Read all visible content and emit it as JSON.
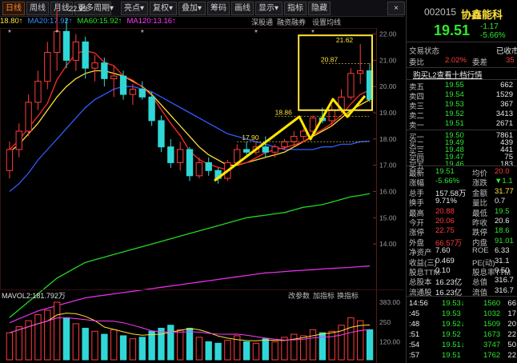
{
  "toolbar": {
    "items": [
      {
        "label": "日线",
        "active": true
      },
      {
        "label": "周线"
      },
      {
        "label": "月线"
      },
      {
        "label": "更多周期▾"
      },
      {
        "label": "亮点▾"
      },
      {
        "label": "复权▾"
      },
      {
        "label": "叠加▾"
      },
      {
        "label": "筹码"
      },
      {
        "label": "画线"
      },
      {
        "label": "显示▾"
      },
      {
        "label": "指标"
      },
      {
        "label": "隐藏"
      }
    ],
    "close_icon": "×"
  },
  "ma_legend": [
    {
      "text": "18.80↑",
      "color": "#ffe33a"
    },
    {
      "text": "MA20:17.92↑",
      "color": "#3a8cff"
    },
    {
      "text": "MA60:15.92↑",
      "color": "#2ee62e"
    },
    {
      "text": "MA120:13.16↑",
      "color": "#ff3bff"
    }
  ],
  "chart_links": [
    "深股通",
    "融资融券",
    "设置均线"
  ],
  "price_axis": [
    "22.00",
    "21.00",
    "20.00",
    "19.00",
    "18.00",
    "17.00",
    "16.00",
    "15.00",
    "14.00"
  ],
  "annotations": {
    "high_label": "←22.99",
    "box_top": "21.62",
    "line1": "20.87",
    "line2": "18.86",
    "line3": "17.90"
  },
  "chart_data": {
    "type": "candlestick",
    "ohlc": [
      [
        16.8,
        17.9,
        16.5,
        17.6
      ],
      [
        17.6,
        18.6,
        17.3,
        18.3
      ],
      [
        18.3,
        19.7,
        18.1,
        19.4
      ],
      [
        19.4,
        20.6,
        19.1,
        20.2
      ],
      [
        20.2,
        21.7,
        19.9,
        21.3
      ],
      [
        21.3,
        22.99,
        20.6,
        22.1
      ],
      [
        22.1,
        22.6,
        20.7,
        21.0
      ],
      [
        21.0,
        22.0,
        20.6,
        21.7
      ],
      [
        21.7,
        21.9,
        20.3,
        20.7
      ],
      [
        20.7,
        21.2,
        20.2,
        20.9
      ],
      [
        20.9,
        21.1,
        20.0,
        20.3
      ],
      [
        20.3,
        20.8,
        19.6,
        20.4
      ],
      [
        20.4,
        20.6,
        19.5,
        19.7
      ],
      [
        19.7,
        20.1,
        19.3,
        19.9
      ],
      [
        19.9,
        20.2,
        19.5,
        19.6
      ],
      [
        19.6,
        19.8,
        18.5,
        18.7
      ],
      [
        18.7,
        18.9,
        17.5,
        17.7
      ],
      [
        17.7,
        18.0,
        16.9,
        17.1
      ],
      [
        17.1,
        17.9,
        16.8,
        17.6
      ],
      [
        17.6,
        17.7,
        16.4,
        16.6
      ],
      [
        16.6,
        17.3,
        16.5,
        17.1
      ],
      [
        17.1,
        17.3,
        16.6,
        16.8
      ],
      [
        16.8,
        16.9,
        16.3,
        16.5
      ],
      [
        16.5,
        17.2,
        16.4,
        17.1
      ],
      [
        17.1,
        17.8,
        17.0,
        17.6
      ],
      [
        17.6,
        17.9,
        17.4,
        17.5
      ],
      [
        17.5,
        17.9,
        17.4,
        17.7
      ],
      [
        17.7,
        18.1,
        17.3,
        17.5
      ],
      [
        17.5,
        17.8,
        17.3,
        17.7
      ],
      [
        17.7,
        18.0,
        17.6,
        17.9
      ],
      [
        17.9,
        18.3,
        17.7,
        18.1
      ],
      [
        18.1,
        18.4,
        17.9,
        18.3
      ],
      [
        18.3,
        18.9,
        18.2,
        18.8
      ],
      [
        18.8,
        19.2,
        18.6,
        18.7
      ],
      [
        18.7,
        19.3,
        18.5,
        19.1
      ],
      [
        19.1,
        19.9,
        19.0,
        19.6
      ],
      [
        19.6,
        20.7,
        19.5,
        20.5
      ],
      [
        20.5,
        21.62,
        20.1,
        20.6
      ],
      [
        20.6,
        20.9,
        19.4,
        19.51
      ]
    ],
    "ma_short": [
      17.5,
      17.8,
      18.2,
      18.6,
      19.1,
      19.6,
      20.0,
      20.3,
      20.5,
      20.6,
      20.6,
      20.5,
      20.4,
      20.2,
      20.0,
      19.7,
      19.3,
      18.9,
      18.5,
      18.1,
      17.7,
      17.4,
      17.2,
      17.0,
      17.0,
      17.1,
      17.2,
      17.3,
      17.4,
      17.5,
      17.7,
      17.9,
      18.1,
      18.3,
      18.5,
      18.8,
      19.1,
      19.3,
      19.5
    ],
    "ma20": [
      16.0,
      16.3,
      16.7,
      17.2,
      17.6,
      18.0,
      18.4,
      18.8,
      19.2,
      19.5,
      19.7,
      19.9,
      20.0,
      20.0,
      19.9,
      19.8,
      19.6,
      19.4,
      19.2,
      19.0,
      18.8,
      18.6,
      18.4,
      18.2,
      18.1,
      18.0,
      17.9,
      17.8,
      17.7,
      17.6,
      17.6,
      17.6,
      17.6,
      17.7,
      17.7,
      17.8,
      17.8,
      17.9,
      17.92
    ],
    "ma60": [
      11.2,
      11.5,
      11.8,
      12.1,
      12.4,
      12.7,
      12.9,
      13.1,
      13.3,
      13.4,
      13.5,
      13.6,
      13.7,
      13.8,
      13.9,
      14.0,
      14.1,
      14.2,
      14.3,
      14.4,
      14.5,
      14.6,
      14.7,
      14.8,
      14.9,
      15.0,
      15.05,
      15.1,
      15.15,
      15.2,
      15.3,
      15.4,
      15.45,
      15.5,
      15.6,
      15.7,
      15.8,
      15.85,
      15.92
    ],
    "ma120": [
      11.0,
      11.15,
      11.3,
      11.45,
      11.55,
      11.65,
      11.75,
      11.85,
      11.95,
      12.0,
      12.05,
      12.1,
      12.15,
      12.2,
      12.25,
      12.3,
      12.35,
      12.4,
      12.45,
      12.5,
      12.55,
      12.6,
      12.65,
      12.7,
      12.75,
      12.8,
      12.85,
      12.9,
      12.92,
      12.95,
      12.98,
      13.0,
      13.02,
      13.05,
      13.07,
      13.09,
      13.11,
      13.14,
      13.16
    ],
    "ylim": [
      13.0,
      22.2
    ],
    "volume": [
      180,
      220,
      260,
      300,
      330,
      383,
      280,
      240,
      210,
      190,
      170,
      200,
      160,
      140,
      150,
      190,
      210,
      230,
      200,
      210,
      150,
      120,
      110,
      130,
      160,
      120,
      110,
      140,
      120,
      150,
      170,
      160,
      200,
      180,
      190,
      230,
      280,
      260,
      200
    ],
    "vol_ylim": [
      0,
      383
    ],
    "vol_axis": [
      "383.00",
      "250",
      "120.00"
    ],
    "vol_legend": "MAVOL2:181.792万",
    "vol_links": [
      "改参数",
      "加指标",
      "换指标"
    ]
  },
  "stock": {
    "code": "002015",
    "name": "协鑫能科",
    "price": "19.51",
    "change": "-1.17",
    "change_pct": "-5.66%"
  },
  "panel": {
    "trade_status_label": "交易状态",
    "trade_status_value": "已收市",
    "wb_label": "委比",
    "wb_value": "2.02%",
    "wc_label": "委差",
    "wc_value": "35",
    "l2_link": "购买L2查看十档行情",
    "asks": [
      {
        "label": "卖五",
        "price": "19.55",
        "vol": "662"
      },
      {
        "label": "卖四",
        "price": "19.54",
        "vol": "1529"
      },
      {
        "label": "卖三",
        "price": "19.53",
        "vol": "367"
      },
      {
        "label": "卖二",
        "price": "19.52",
        "vol": "3413"
      },
      {
        "label": "卖一",
        "price": "19.51",
        "vol": "2671"
      }
    ],
    "bids": [
      {
        "label": "买一",
        "price": "19.50",
        "vol": "7861"
      },
      {
        "label": "买二",
        "price": "19.49",
        "vol": "439"
      },
      {
        "label": "买三",
        "price": "19.48",
        "vol": "441"
      },
      {
        "label": "买四",
        "price": "19.47",
        "vol": "75"
      },
      {
        "label": "买五",
        "price": "19.46",
        "vol": "183"
      }
    ],
    "stats": [
      {
        "l1": "最新",
        "v1": "19.51",
        "c1": "green",
        "l2": "均价",
        "v2": "20.0",
        "c2": "red"
      },
      {
        "l1": "涨幅",
        "v1": "-5.66%",
        "c1": "green",
        "l2": "涨跌",
        "v2": "▼1.1",
        "c2": "green"
      },
      {
        "l1": "总手",
        "v1": "157.58万",
        "c1": "white",
        "l2": "金额",
        "v2": "31.77",
        "c2": "yellow"
      },
      {
        "l1": "换手",
        "v1": "9.71%",
        "c1": "white",
        "l2": "量比",
        "v2": "0.7",
        "c2": "white"
      },
      {
        "l1": "最高",
        "v1": "20.88",
        "c1": "red",
        "l2": "最低",
        "v2": "19.5",
        "c2": "green"
      },
      {
        "l1": "今开",
        "v1": "20.06",
        "c1": "red",
        "l2": "昨收",
        "v2": "20.6",
        "c2": "white"
      },
      {
        "l1": "涨停",
        "v1": "22.75",
        "c1": "red",
        "l2": "跌停",
        "v2": "18.6",
        "c2": "green"
      },
      {
        "l1": "外盘",
        "v1": "66.57万",
        "c1": "red",
        "l2": "内盘",
        "v2": "91.01",
        "c2": "green"
      },
      {
        "l1": "净资产",
        "v1": "7.60",
        "c1": "white",
        "l2": "ROE",
        "v2": "6.33",
        "c2": "white"
      },
      {
        "l1": "收益(三)",
        "v1": "0.469",
        "c1": "white",
        "l2": "PE(动)",
        "v2": "31.1",
        "c2": "white"
      },
      {
        "l1": "股息TTM",
        "v1": "0.10",
        "c1": "white",
        "l2": "股息率TTM",
        "v2": "0.50",
        "c2": "white"
      },
      {
        "l1": "总股本",
        "v1": "16.23亿",
        "c1": "white",
        "l2": "总值",
        "v2": "316.7",
        "c2": "white"
      },
      {
        "l1": "流通股",
        "v1": "16.23亿",
        "c1": "white",
        "l2": "流值",
        "v2": "316.7",
        "c2": "white"
      }
    ],
    "ticks": [
      {
        "time": "14:56",
        "price": "19.53",
        "arrow": "↓",
        "vol": "1560",
        "count": "66"
      },
      {
        "time": ":45",
        "price": "19.53",
        "arrow": "",
        "vol": "1032",
        "count": "17"
      },
      {
        "time": ":48",
        "price": "19.52",
        "arrow": "↓",
        "vol": "1509",
        "count": "20"
      },
      {
        "time": ":51",
        "price": "19.52",
        "arrow": "",
        "vol": "1673",
        "count": "22"
      },
      {
        "time": ":54",
        "price": "19.51",
        "arrow": "↓",
        "vol": "3747",
        "count": "50"
      },
      {
        "time": ":57",
        "price": "19.51",
        "arrow": "",
        "vol": "1762",
        "count": "22"
      }
    ]
  }
}
